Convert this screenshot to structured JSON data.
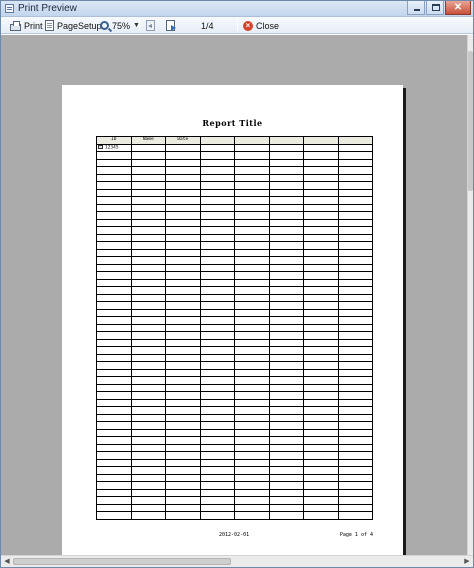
{
  "window": {
    "title": "Print Preview"
  },
  "toolbar": {
    "print_label": "Print",
    "page_setup_label": "PageSetup",
    "zoom_label": "75%",
    "page_indicator": "1/4",
    "close_label": "Close"
  },
  "report": {
    "title": "Report Title",
    "columns": [
      "ID",
      "Name",
      "Date",
      "",
      "",
      "",
      "",
      ""
    ],
    "rows": [
      [
        "12345",
        "",
        "",
        "",
        "",
        "",
        "",
        ""
      ]
    ],
    "row_count": 50,
    "footer_date": "2012-02-01",
    "footer_page": "Page 1 of 4"
  },
  "colors": {
    "paper_background": "#ffffff",
    "viewport_background": "#ababab",
    "header_cell_background": "#ecebe0",
    "close_icon": "#d8412a"
  },
  "icons": [
    "print-icon",
    "page-setup-icon",
    "zoom-icon",
    "prev-page-icon",
    "next-page-icon",
    "close-icon"
  ]
}
